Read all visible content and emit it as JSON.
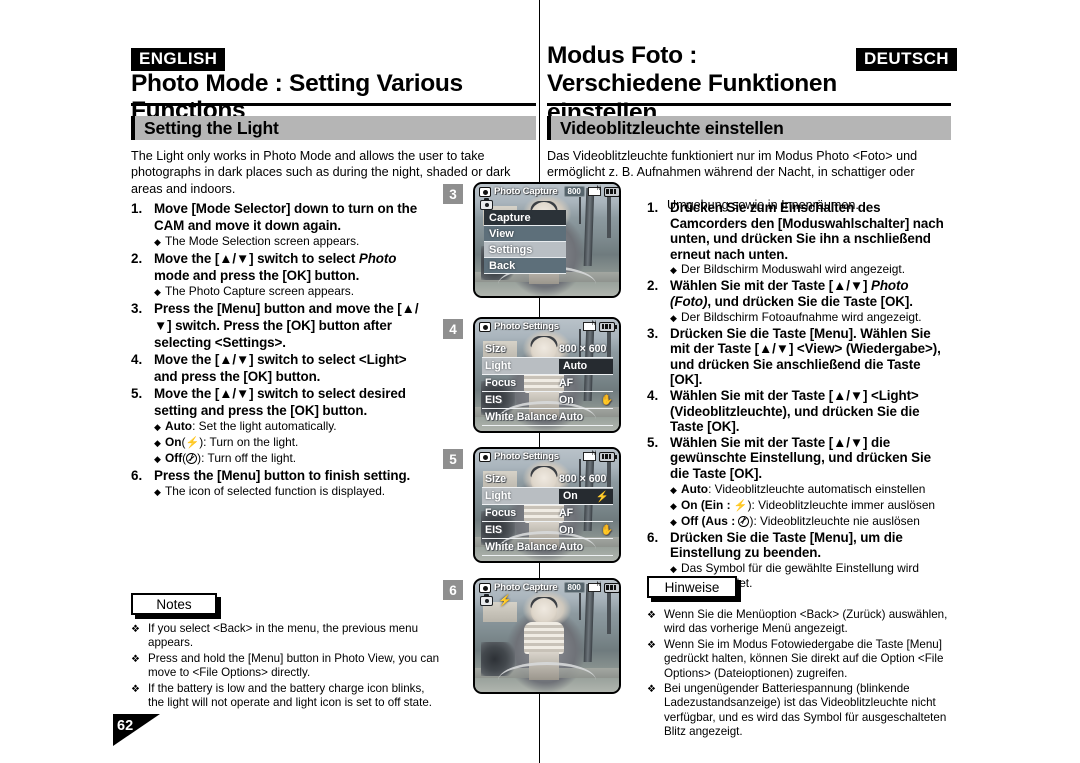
{
  "page": {
    "number": "62",
    "lang_tag_left": "ENGLISH",
    "lang_tag_right": "DEUTSCH"
  },
  "english": {
    "chapter_title": "Photo Mode : Setting Various Functions",
    "section_title": "Setting the Light",
    "intro": "The Light only works in Photo Mode and allows the user to take photographs in dark places such as during the night, shaded or dark areas and indoors.",
    "steps": [
      {
        "num": "1.",
        "text": "Move [Mode Selector] down to turn on the CAM and move it down again.",
        "subs": [
          "The Mode Selection screen appears."
        ]
      },
      {
        "num": "2.",
        "text_pre": "Move the [▲/▼] switch to select ",
        "text_italic": "Photo",
        "text_post": " mode and press the [OK] button.",
        "subs": [
          "The Photo Capture screen appears."
        ]
      },
      {
        "num": "3.",
        "text": "Press the [Menu] button and move the [▲/▼] switch. Press the [OK] button after selecting <Settings>.",
        "subs": []
      },
      {
        "num": "4.",
        "text": "Move the [▲/▼] switch to select <Light> and press the [OK] button.",
        "subs": []
      },
      {
        "num": "5.",
        "text": "Move the [▲/▼] switch to select desired setting and press the [OK] button.",
        "subs": []
      },
      {
        "num": "6.",
        "text": "Press the [Menu] button to finish setting.",
        "subs": [
          "The icon of selected function is displayed."
        ]
      }
    ],
    "light_options": [
      {
        "name": "Auto",
        "icon": "",
        "desc": ": Set the light automatically."
      },
      {
        "name": "On",
        "icon": "flash-icon",
        "desc": "): Turn on the light."
      },
      {
        "name": "Off",
        "icon": "no-flash-icon",
        "desc": "): Turn off the light."
      }
    ],
    "notes_label": "Notes",
    "notes": [
      "If you select <Back> in the menu, the previous menu appears.",
      "Press and hold the [Menu] button in Photo View, you can move to <File Options> directly.",
      "If the battery is low and the battery charge icon blinks, the light will not operate and light icon is set to off state."
    ]
  },
  "german": {
    "chapter_title_line1": "Modus Foto :",
    "chapter_title_line2": "Verschiedene Funktionen einstellen",
    "section_title": "Videoblitzleuchte einstellen",
    "intro_line1": "Das Videoblitzleuchte funktioniert nur im Modus Photo <Foto> und",
    "intro_line2": "ermöglicht z. B. Aufnahmen während der Nacht, in schattiger oder dunkler",
    "intro_line3": "Umgebung sowie in Innenräumen.",
    "steps": [
      {
        "num": "1.",
        "text": "Drücken Sie zum Einschalten des Camcorders den [Moduswahlschalter] nach unten, und drücken Sie ihn a nschließend erneut nach unten.",
        "subs": [
          "Der Bildschirm Moduswahl wird angezeigt."
        ]
      },
      {
        "num": "2.",
        "text_pre": "Wählen Sie mit der Taste [▲/▼] ",
        "text_italic": "Photo (Foto)",
        "text_post": ", und drücken Sie die Taste [OK].",
        "subs": [
          "Der Bildschirm Fotoaufnahme wird angezeigt."
        ]
      },
      {
        "num": "3.",
        "text": "Drücken Sie die Taste [Menu]. Wählen Sie mit der Taste [▲/▼] <View> (Wiedergabe>), und drücken Sie anschließend die Taste [OK].",
        "subs": []
      },
      {
        "num": "4.",
        "text": "Wählen Sie mit der Taste [▲/▼] <Light> (Videoblitzleuchte), und drücken Sie die Taste [OK].",
        "subs": []
      },
      {
        "num": "5.",
        "text": "Wählen Sie mit der Taste [▲/▼] die gewünschte Einstellung, und drücken Sie die Taste [OK].",
        "subs": []
      },
      {
        "num": "6.",
        "text": "Drücken Sie die Taste [Menu], um die Einstellung zu beenden.",
        "subs": [
          "Das Symbol für die gewählte Einstellung wird eingeblendet."
        ]
      }
    ],
    "light_options": [
      {
        "name": "Auto",
        "icon": "",
        "desc": ": Videoblitzleuchte automatisch einstellen"
      },
      {
        "name": "On (Ein :",
        "icon": "flash-icon",
        "desc": "): Videoblitzleuchte immer auslösen"
      },
      {
        "name": "Off (Aus :",
        "icon": "no-flash-icon",
        "desc": "): Videoblitzleuchte nie auslösen"
      }
    ],
    "notes_label": "Hinweise",
    "notes": [
      "Wenn Sie die Menüoption <Back> (Zurück) auswählen, wird das vorherige Menü angezeigt.",
      "Wenn Sie im Modus Fotowiedergabe die Taste [Menu] gedrückt halten, können Sie direkt auf die Option <File Options> (Dateioptionen) zugreifen.",
      "Bei ungenügender Batteriespannung (blinkende Ladezustandsanzeige) ist das Videoblitzleuchte nicht verfügbar, und es wird das Symbol für ausgeschalteten Blitz angezeigt."
    ]
  },
  "lcd_screens": [
    {
      "badge": "3",
      "osd_title": "Photo Capture",
      "osd_resolution": "800",
      "kind": "menu",
      "menu_items": [
        {
          "label": "Capture",
          "state": "selected"
        },
        {
          "label": "View",
          "state": "normal"
        },
        {
          "label": "Settings",
          "state": "alt"
        },
        {
          "label": "Back",
          "state": "normal"
        }
      ]
    },
    {
      "badge": "4",
      "osd_title": "Photo Settings",
      "osd_resolution": "",
      "kind": "settings",
      "rows": [
        {
          "label": "Size",
          "value": "800 × 600",
          "icon": "",
          "highlight": false
        },
        {
          "label": "Light",
          "value": "Auto",
          "icon": "",
          "highlight": true
        },
        {
          "label": "Focus",
          "value": "AF",
          "icon": "",
          "highlight": false
        },
        {
          "label": "EIS",
          "value": "On",
          "icon": "hand-icon",
          "highlight": false
        },
        {
          "label": "White Balance",
          "value": "Auto",
          "icon": "",
          "highlight": false
        }
      ]
    },
    {
      "badge": "5",
      "osd_title": "Photo Settings",
      "osd_resolution": "",
      "kind": "settings",
      "rows": [
        {
          "label": "Size",
          "value": "800 × 600",
          "icon": "",
          "highlight": false
        },
        {
          "label": "Light",
          "value": "On",
          "icon": "flash-icon",
          "highlight": true
        },
        {
          "label": "Focus",
          "value": "AF",
          "icon": "",
          "highlight": false
        },
        {
          "label": "EIS",
          "value": "On",
          "icon": "hand-icon",
          "highlight": false
        },
        {
          "label": "White Balance",
          "value": "Auto",
          "icon": "",
          "highlight": false
        }
      ]
    },
    {
      "badge": "6",
      "osd_title": "Photo Capture",
      "osd_resolution": "800",
      "kind": "preview",
      "indicator_icons": [
        "camera-icon",
        "flash-icon"
      ]
    }
  ]
}
